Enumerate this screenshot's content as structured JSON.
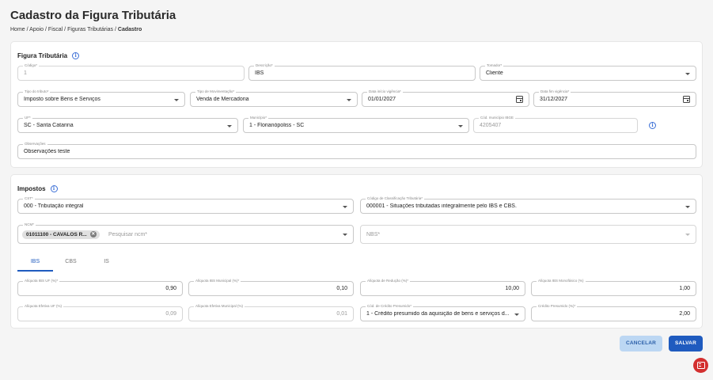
{
  "header": {
    "title": "Cadastro da Figura Tributária",
    "breadcrumb": [
      "Home",
      "Apoio",
      "Fiscal",
      "Figuras Tributárias"
    ],
    "breadcrumb_current": "Cadastro",
    "separator": "/"
  },
  "figura": {
    "title": "Figura Tributária",
    "codigo": {
      "label": "Código*",
      "value": "1"
    },
    "descricao": {
      "label": "Descrição*",
      "value": "IBS"
    },
    "tomador": {
      "label": "Tomador*",
      "value": "Cliente"
    },
    "tipo_tributo": {
      "label": "Tipo do tributo*",
      "value": "Imposto sobre Bens e Serviços"
    },
    "tipo_movimentacao": {
      "label": "Tipo de Movimentação*",
      "value": "Venda de Mercadoria"
    },
    "data_inicio": {
      "label": "Data início vigência*",
      "value": "01/01/2027"
    },
    "data_fim": {
      "label": "Data fim vigência*",
      "value": "31/12/2027"
    },
    "uf": {
      "label": "UF*",
      "value": "SC - Santa Catarina"
    },
    "municipio": {
      "label": "Município*",
      "value": "1 - Florianópoliss - SC"
    },
    "cod_ibge": {
      "label": "Cód. município IBGE",
      "value": "4205407"
    },
    "observacoes": {
      "label": "Observações",
      "value": "Observações teste"
    }
  },
  "impostos": {
    "title": "Impostos",
    "cst": {
      "label": "CST*",
      "value": "000 - Tributação integral"
    },
    "classificacao": {
      "label": "Código de Classificação Tributária*",
      "value": "000001 - Situações tributadas integralmente pelo IBS e CBS."
    },
    "ncm": {
      "label": "NCM*",
      "chip": "01011100 - CAVALOS R...",
      "chip_remove": "✕",
      "placeholder": "Pesquisar ncm*"
    },
    "nbs": {
      "placeholder": "NBS*"
    },
    "tabs": [
      {
        "label": "IBS",
        "active": true
      },
      {
        "label": "CBS",
        "active": false
      },
      {
        "label": "IS",
        "active": false
      }
    ],
    "aliquota_uf": {
      "label": "Alíquota IBS UF (%)*",
      "value": "0,90"
    },
    "aliquota_municipal": {
      "label": "Alíquota IBS Municipal (%)*",
      "value": "0,10"
    },
    "aliquota_reducao": {
      "label": "Alíquota de Redução (%)*",
      "value": "10,00"
    },
    "aliquota_monofasico": {
      "label": "Alíquota IBS Monofásico (%)",
      "value": "1,00"
    },
    "aliquota_efetiva_uf": {
      "label": "Alíquota Efetiva UF (%)",
      "value": "0,09"
    },
    "aliquota_efetiva_municipal": {
      "label": "Alíquota Efetiva Municipal (%)",
      "value": "0,01"
    },
    "credito_presumido_cod": {
      "label": "Cód. de Crédito Presumido*",
      "value": "1 - Crédito presumido da aquisição de bens e serviços d..."
    },
    "credito_presumido": {
      "label": "Crédito Presumido (%)*",
      "value": "2,00"
    }
  },
  "actions": {
    "cancel_label": "CANCELAR",
    "save_label": "SALVAR"
  },
  "colors": {
    "accent": "#1f5bbf",
    "cancel_bg": "#bcd7f3",
    "fab": "#d32f2f"
  }
}
